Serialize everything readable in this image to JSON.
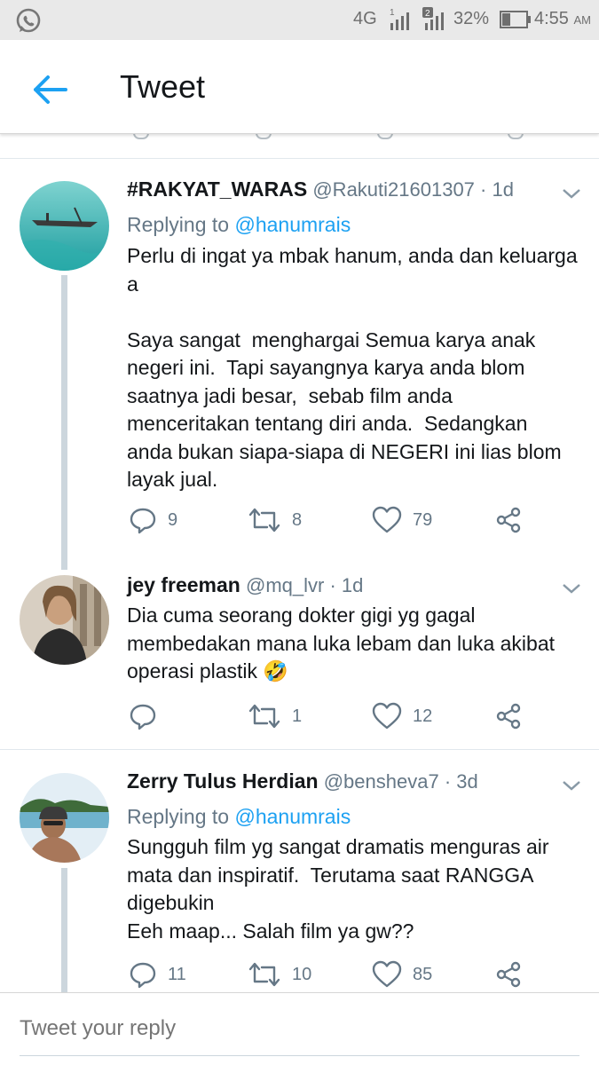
{
  "status_bar": {
    "network": "4G",
    "sim1_label": "1",
    "sim2_label": "2",
    "battery": "32%",
    "time": "4:55",
    "ampm": "AM"
  },
  "header": {
    "title": "Tweet"
  },
  "tweets": [
    {
      "name": "#RAKYAT_WARAS",
      "handle": "@Rakuti21601307",
      "dot": "·",
      "ago": "1d",
      "replying_to_prefix": "Replying to ",
      "replying_to": "@hanumrais",
      "text": "Perlu di ingat ya mbak hanum, anda dan keluarga\na\n\nSaya sangat  menghargai Semua karya anak\nnegeri ini.  Tapi sayangnya karya anda blom\nsaatnya jadi besar,  sebab film anda\nmenceritakan tentang diri anda.  Sedangkan\nanda bukan siapa-siapa di NEGERI ini lias blom\nlayak jual.",
      "replies": "9",
      "retweets": "8",
      "likes": "79"
    },
    {
      "name": "jey freeman",
      "handle": "@mq_lvr",
      "dot": "·",
      "ago": "1d",
      "text": "Dia cuma seorang dokter gigi yg gagal\nmembedakan mana luka lebam dan luka akibat\noperasi plastik 🤣",
      "replies": "",
      "retweets": "1",
      "likes": "12"
    },
    {
      "name": "Zerry Tulus Herdian",
      "handle": "@bensheva7",
      "dot": "·",
      "ago": "3d",
      "replying_to_prefix": "Replying to ",
      "replying_to": "@hanumrais",
      "text": "Sungguh film yg sangat dramatis menguras air\nmata dan inspiratif.  Terutama saat RANGGA\ndigebukin\nEeh maap... Salah film ya gw??",
      "replies": "11",
      "retweets": "10",
      "likes": "85"
    }
  ],
  "composer": {
    "placeholder": "Tweet your reply"
  },
  "colors": {
    "accent": "#1da1f2",
    "secondary_text": "#657786",
    "primary_text": "#14171a",
    "thread_line": "#ccd6dd"
  }
}
